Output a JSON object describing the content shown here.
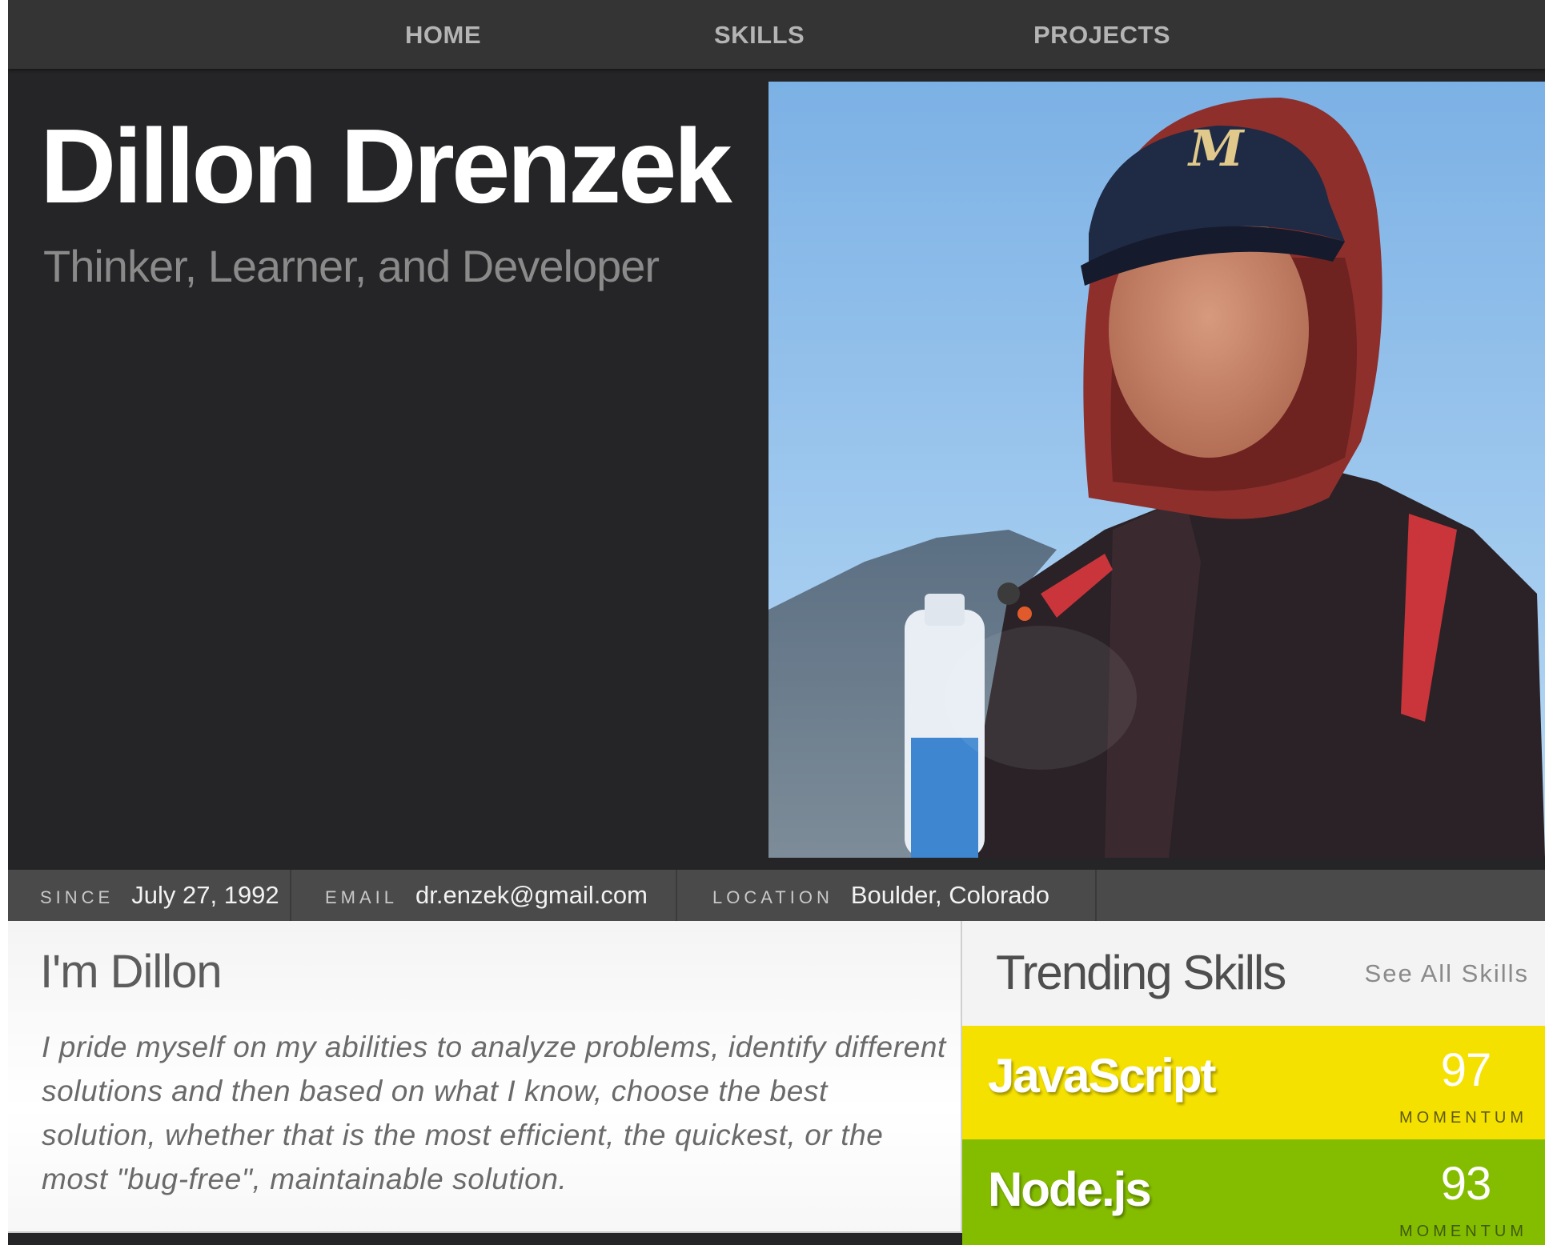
{
  "nav": {
    "items": [
      {
        "label": "HOME"
      },
      {
        "label": "SKILLS"
      },
      {
        "label": "PROJECTS"
      }
    ]
  },
  "hero": {
    "name": "Dillon Drenzek",
    "tagline": "Thinker, Learner, and Developer",
    "photo_icon": "profile-photo"
  },
  "info": {
    "since_label": "SINCE",
    "since_value": "July 27, 1992",
    "email_label": "EMAIL",
    "email_value": "dr.enzek@gmail.com",
    "location_label": "LOCATION",
    "location_value": "Boulder, Colorado"
  },
  "about": {
    "title": "I'm Dillon",
    "text": "I pride myself on my abilities to analyze problems, identify different solutions and then based on what I know, choose the best solution, whether that is the most efficient, the quickest, or the most \"bug-free\", maintainable solution."
  },
  "skills": {
    "title": "Trending Skills",
    "see_all": "See All Skills",
    "items": [
      {
        "name": "JavaScript",
        "score": "97",
        "caption": "MOMENTUM",
        "color": "#f5e100"
      },
      {
        "name": "Node.js",
        "score": "93",
        "caption": "MOMENTUM",
        "color": "#84bd00"
      }
    ]
  }
}
